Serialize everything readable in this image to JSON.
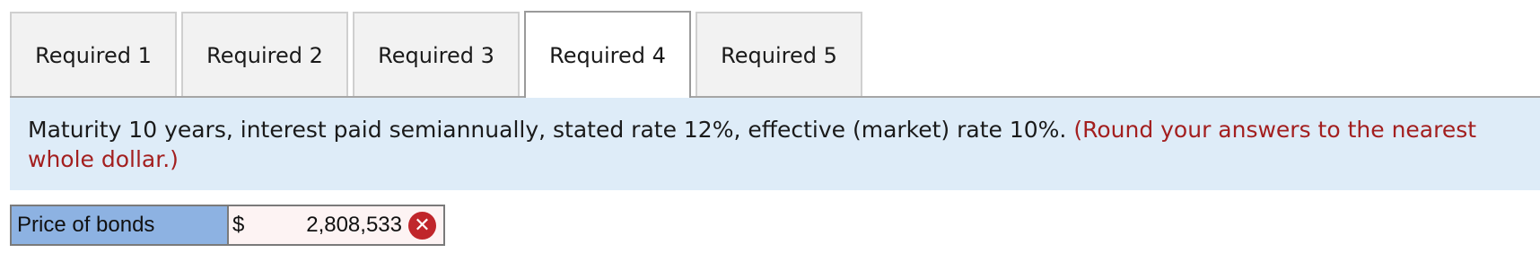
{
  "tabs": [
    {
      "label": "Required 1",
      "active": false
    },
    {
      "label": "Required 2",
      "active": false
    },
    {
      "label": "Required 3",
      "active": false
    },
    {
      "label": "Required 4",
      "active": true
    },
    {
      "label": "Required 5",
      "active": false
    }
  ],
  "instructions": {
    "text": "Maturity 10 years, interest paid semiannually, stated rate 12%, effective (market) rate 10%.",
    "note": "(Round your answers to the nearest whole dollar.)"
  },
  "answer": {
    "label": "Price of bonds",
    "currency": "$",
    "value": "2,808,533",
    "status": "incorrect",
    "status_icon": "x-mark-icon",
    "status_color": "#c0262b"
  },
  "colors": {
    "panel_background": "#deecf8",
    "note_text": "#a31f1f",
    "label_cell": "#8db2e2",
    "input_cell": "#fdf3f3"
  }
}
